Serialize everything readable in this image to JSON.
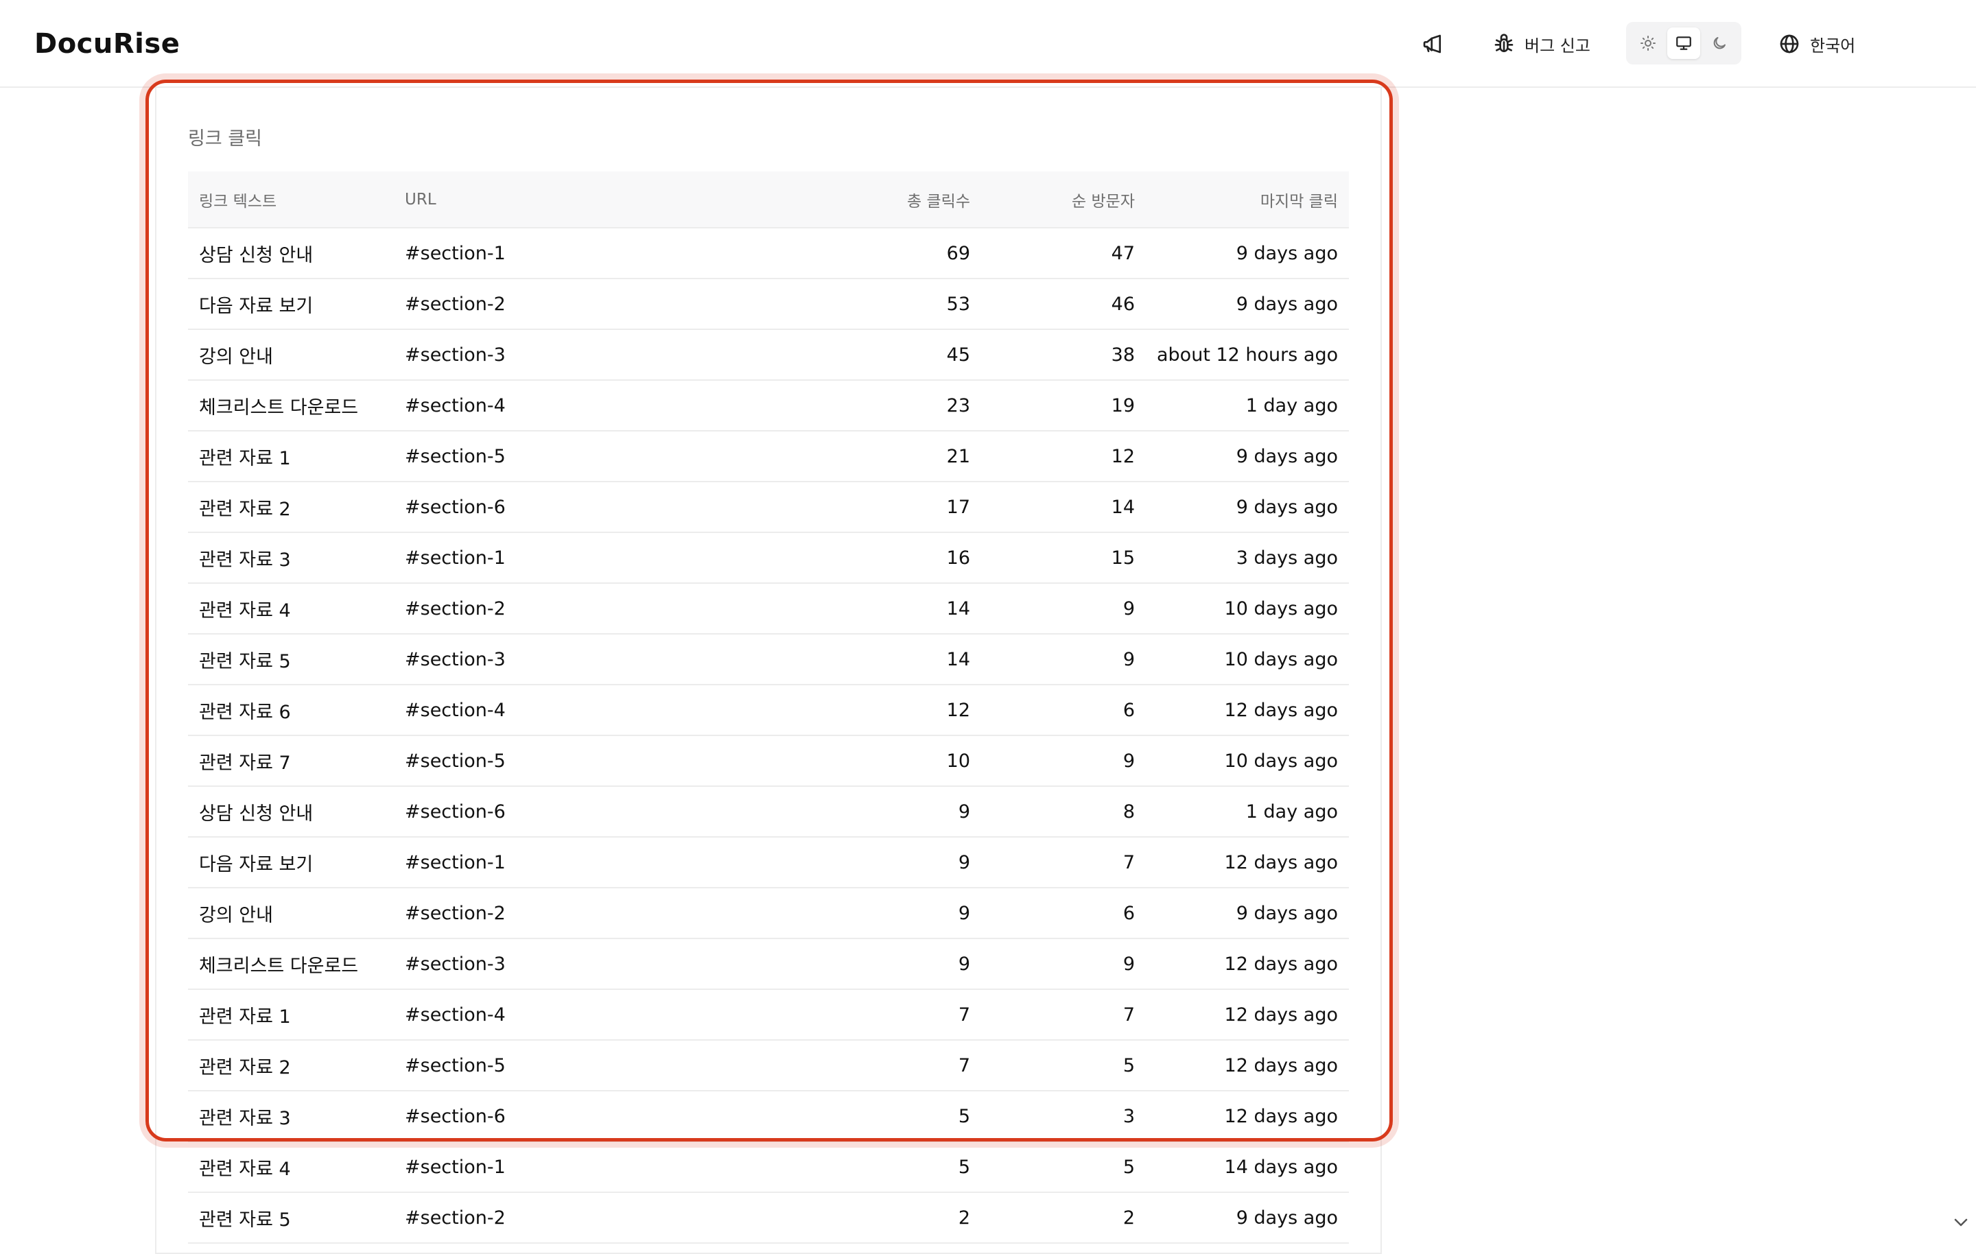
{
  "header": {
    "logo": "DocuRise",
    "announce_icon": "megaphone-icon",
    "bug_label": "버그 신고",
    "bug_icon": "bug-icon",
    "theme_options": [
      "light",
      "system",
      "dark"
    ],
    "theme_selected": "system",
    "language_label": "한국어",
    "language_icon": "globe-icon"
  },
  "section": {
    "title": "링크 클릭"
  },
  "table": {
    "headers": {
      "link_text": "링크 텍스트",
      "url": "URL",
      "total_clicks": "총 클릭수",
      "unique_visitors": "순 방문자",
      "last_click": "마지막 클릭"
    },
    "rows": [
      {
        "text": "상담 신청 안내",
        "url": "#section-1",
        "total": "69",
        "unique": "47",
        "last": "9 days ago"
      },
      {
        "text": "다음 자료 보기",
        "url": "#section-2",
        "total": "53",
        "unique": "46",
        "last": "9 days ago"
      },
      {
        "text": "강의 안내",
        "url": "#section-3",
        "total": "45",
        "unique": "38",
        "last": "about 12 hours ago"
      },
      {
        "text": "체크리스트 다운로드",
        "url": "#section-4",
        "total": "23",
        "unique": "19",
        "last": "1 day ago"
      },
      {
        "text": "관련 자료 1",
        "url": "#section-5",
        "total": "21",
        "unique": "12",
        "last": "9 days ago"
      },
      {
        "text": "관련 자료 2",
        "url": "#section-6",
        "total": "17",
        "unique": "14",
        "last": "9 days ago"
      },
      {
        "text": "관련 자료 3",
        "url": "#section-1",
        "total": "16",
        "unique": "15",
        "last": "3 days ago"
      },
      {
        "text": "관련 자료 4",
        "url": "#section-2",
        "total": "14",
        "unique": "9",
        "last": "10 days ago"
      },
      {
        "text": "관련 자료 5",
        "url": "#section-3",
        "total": "14",
        "unique": "9",
        "last": "10 days ago"
      },
      {
        "text": "관련 자료 6",
        "url": "#section-4",
        "total": "12",
        "unique": "6",
        "last": "12 days ago"
      },
      {
        "text": "관련 자료 7",
        "url": "#section-5",
        "total": "10",
        "unique": "9",
        "last": "10 days ago"
      },
      {
        "text": "상담 신청 안내",
        "url": "#section-6",
        "total": "9",
        "unique": "8",
        "last": "1 day ago"
      },
      {
        "text": "다음 자료 보기",
        "url": "#section-1",
        "total": "9",
        "unique": "7",
        "last": "12 days ago"
      },
      {
        "text": "강의 안내",
        "url": "#section-2",
        "total": "9",
        "unique": "6",
        "last": "9 days ago"
      },
      {
        "text": "체크리스트 다운로드",
        "url": "#section-3",
        "total": "9",
        "unique": "9",
        "last": "12 days ago"
      },
      {
        "text": "관련 자료 1",
        "url": "#section-4",
        "total": "7",
        "unique": "7",
        "last": "12 days ago"
      },
      {
        "text": "관련 자료 2",
        "url": "#section-5",
        "total": "7",
        "unique": "5",
        "last": "12 days ago"
      },
      {
        "text": "관련 자료 3",
        "url": "#section-6",
        "total": "5",
        "unique": "3",
        "last": "12 days ago"
      },
      {
        "text": "관련 자료 4",
        "url": "#section-1",
        "total": "5",
        "unique": "5",
        "last": "14 days ago"
      },
      {
        "text": "관련 자료 5",
        "url": "#section-2",
        "total": "2",
        "unique": "2",
        "last": "9 days ago"
      }
    ]
  },
  "colors": {
    "focus_ring": "#d83a1c",
    "muted_text": "#6e6e6e",
    "border": "#ececec"
  }
}
